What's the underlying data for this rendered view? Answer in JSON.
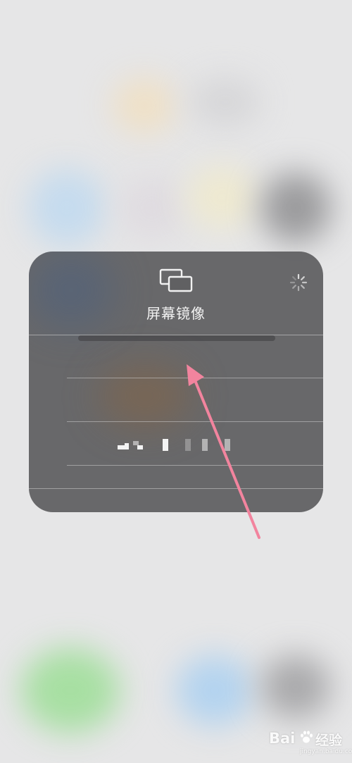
{
  "screen_mirroring": {
    "title": "屏幕镜像",
    "icon": "screen-mirroring-icon",
    "status_icon": "loading-spinner-icon",
    "devices": [
      {
        "label": ""
      },
      {
        "label": ""
      },
      {
        "label": ""
      }
    ]
  },
  "annotation": {
    "arrow_color": "#f2849e"
  },
  "watermark": {
    "brand": "Bai",
    "brand_suffix": "经验",
    "site": "jingyan.baidu.com"
  }
}
